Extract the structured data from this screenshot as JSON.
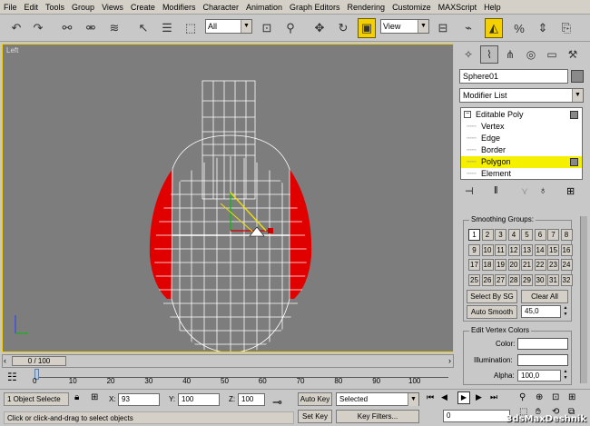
{
  "menu": [
    "File",
    "Edit",
    "Tools",
    "Group",
    "Views",
    "Create",
    "Modifiers",
    "Character",
    "Animation",
    "Graph Editors",
    "Rendering",
    "Customize",
    "MAXScript",
    "Help"
  ],
  "toolbar": {
    "selection_filter": "All",
    "ref_coord": "View",
    "viewport_label": "Left"
  },
  "cmd_panel": {
    "object_name": "Sphere01",
    "modifier_list": "Modifier List",
    "stack": [
      {
        "label": "Editable Poly",
        "selected": false
      },
      {
        "label": "Vertex",
        "selected": false
      },
      {
        "label": "Edge",
        "selected": false
      },
      {
        "label": "Border",
        "selected": false
      },
      {
        "label": "Polygon",
        "selected": true
      },
      {
        "label": "Element",
        "selected": false
      }
    ],
    "smoothing_title": "Smoothing Groups:",
    "smoothing_groups": [
      "1",
      "2",
      "3",
      "4",
      "5",
      "6",
      "7",
      "8",
      "9",
      "10",
      "11",
      "12",
      "13",
      "14",
      "15",
      "16",
      "17",
      "18",
      "19",
      "20",
      "21",
      "22",
      "23",
      "24",
      "25",
      "26",
      "27",
      "28",
      "29",
      "30",
      "31",
      "32"
    ],
    "select_by_sg": "Select By SG",
    "clear_all": "Clear All",
    "auto_smooth": "Auto Smooth",
    "auto_smooth_value": "45,0",
    "vertex_colors_title": "Edit Vertex Colors",
    "color_label": "Color:",
    "illumination_label": "Illumination:",
    "alpha_label": "Alpha:",
    "alpha_value": "100,0"
  },
  "timeline": {
    "frame": "0 / 100",
    "ticks": [
      "0",
      "10",
      "20",
      "30",
      "40",
      "50",
      "60",
      "70",
      "80",
      "90",
      "100"
    ]
  },
  "status": {
    "selected": "1 Object Selecte",
    "x_label": "X:",
    "x_value": "93",
    "y_label": "Y:",
    "y_value": "100",
    "z_label": "Z:",
    "z_value": "100",
    "auto_key": "Auto Key",
    "selected_dropdown": "Selected",
    "set_key": "Set Key",
    "key_filters": "Key Filters...",
    "prompt": "Click or click-and-drag to select objects",
    "frame_value": "0"
  },
  "watermark": "3dsMaxDeshnik"
}
